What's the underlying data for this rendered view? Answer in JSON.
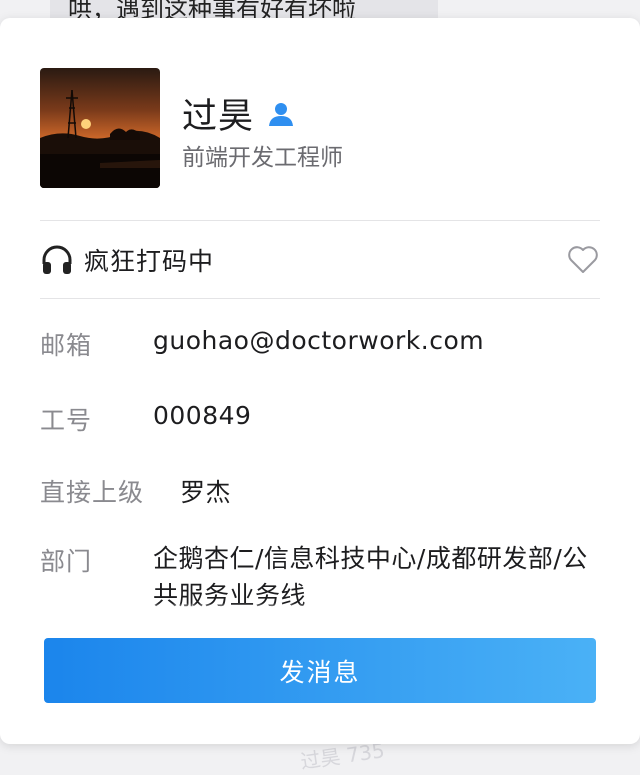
{
  "background": {
    "chat_snippet": "哄，遇到这种事有好有坏啦",
    "watermark": "过昊 735"
  },
  "profile": {
    "name": "过昊",
    "title": "前端开发工程师",
    "avatar": "sunset-tower-photo"
  },
  "status": {
    "icon": "headphones-icon",
    "text": "疯狂打码中",
    "favorite_icon": "heart-outline-icon"
  },
  "fields": {
    "email": {
      "label": "邮箱",
      "value": "guohao@doctorwork.com"
    },
    "employee_id": {
      "label": "工号",
      "value": "000849"
    },
    "manager": {
      "label": "直接上级",
      "value": "罗杰"
    },
    "department": {
      "label": "部门",
      "value": "企鹅杏仁/信息科技中心/成都研发部/公共服务业务线"
    }
  },
  "actions": {
    "send_message_label": "发消息"
  },
  "colors": {
    "accent_start": "#1b85ec",
    "accent_end": "#4ab1f6",
    "user_icon": "#2f8ff0",
    "label_gray": "#8a8a8f"
  }
}
